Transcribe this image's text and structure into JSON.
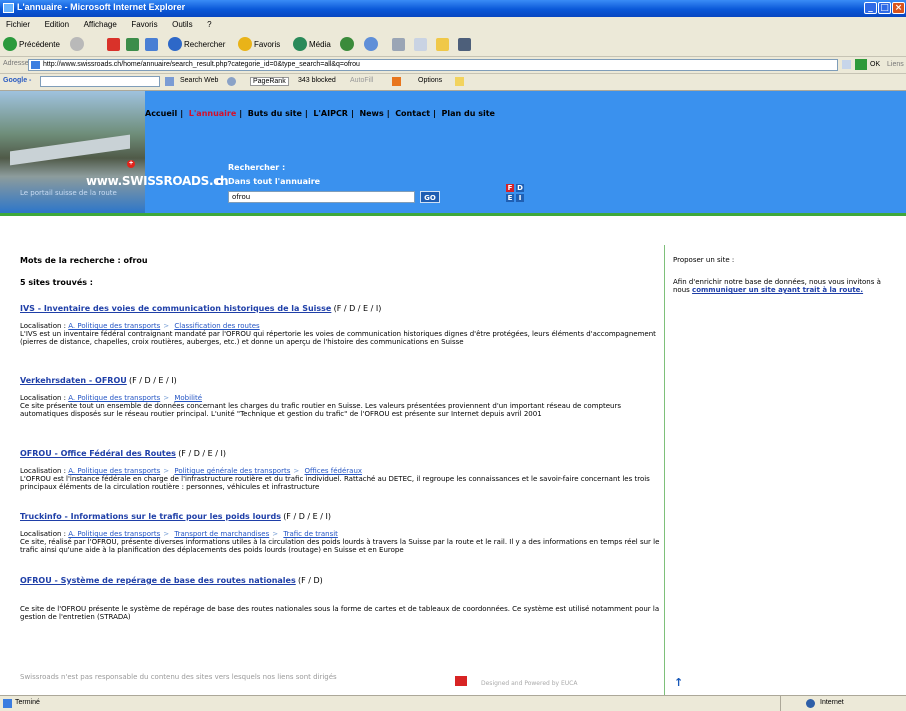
{
  "window": {
    "title": "L'annuaire - Microsoft Internet Explorer"
  },
  "menu": [
    "Fichier",
    "Edition",
    "Affichage",
    "Favoris",
    "Outils",
    "?"
  ],
  "toolbar": {
    "back": "Précédente",
    "search": "Rechercher",
    "favorites": "Favoris",
    "media": "Média"
  },
  "address": {
    "label": "Adresse",
    "url": "http://www.swissroads.ch/home/annuaire/search_result.php?categorie_id=0&type_search=all&q=ofrou",
    "go": "OK",
    "links": "Liens"
  },
  "googlebar": {
    "brand": "Google -",
    "search_web": "Search Web",
    "pagerank": "PageRank",
    "blocked": "343 blocked",
    "autofill": "AutoFill",
    "options": "Options"
  },
  "site": {
    "nav": [
      "Accueil",
      "L'annuaire",
      "Buts du site",
      "L'AIPCR",
      "News",
      "Contact",
      "Plan du site"
    ],
    "logo": "www.SWISSROADS.ch",
    "tagline": "Le portail suisse de la route",
    "search_label": "Rechercher :",
    "radio_label": "Dans tout l'annuaire",
    "query": "ofrou",
    "go": "GO",
    "langs": [
      "F",
      "D",
      "E",
      "I"
    ]
  },
  "results": {
    "keywords": "Mots de la recherche : ofrou",
    "count": "5 sites trouvés :",
    "loc_label": "Localisation :",
    "items": [
      {
        "title": "IVS - Inventaire des voies de communication historiques de la Suisse",
        "lang": "(F / D / E / I)",
        "path": [
          "A. Politique des transports",
          "Classification des routes"
        ],
        "desc": "L'IVS est un inventaire fédéral contraignant mandaté par l'OFROU qui répertorie les voies de communication historiques dignes d'être protégées, leurs éléments d'accompagnement (pierres de distance, chapelles, croix routières, auberges, etc.) et donne un aperçu de l'histoire des communications en Suisse"
      },
      {
        "title": "Verkehrsdaten - OFROU",
        "lang": "(F / D / E / I)",
        "path": [
          "A. Politique des transports",
          "Mobilité"
        ],
        "desc": "Ce site présente tout un ensemble de données concernant les charges du trafic routier en Suisse. Les valeurs présentées proviennent d'un important réseau de compteurs automatiques disposés sur le réseau routier principal. L'unité \"Technique et gestion du trafic\" de l'OFROU est présente sur Internet depuis avril 2001"
      },
      {
        "title": "OFROU - Office Fédéral des Routes",
        "lang": "(F / D / E / I)",
        "path": [
          "A. Politique des transports",
          "Politique générale des transports",
          "Offices fédéraux"
        ],
        "desc": "L'OFROU est l'instance fédérale en charge de l'infrastructure routière et du trafic individuel. Rattaché au DETEC, il regroupe les connaissances et le savoir-faire concernant les trois principaux éléments de la circulation routière : personnes, véhicules et infrastructure"
      },
      {
        "title": "Truckinfo - Informations sur le trafic pour les poids lourds",
        "lang": "(F / D / E / I)",
        "path": [
          "A. Politique des transports",
          "Transport de marchandises",
          "Trafic de transit"
        ],
        "desc": "Ce site, réalisé par l'OFROU, présente diverses informations utiles à la circulation des poids lourds à travers la Suisse par la route et le rail. Il y a des informations en temps réel sur le trafic ainsi qu'une aide à la planification des déplacements des poids lourds (routage) en Suisse et en Europe"
      },
      {
        "title": "OFROU - Système de repérage de base des routes nationales",
        "lang": "(F / D)",
        "path": [],
        "desc": "Ce site de l'OFROU présente le système de repérage de base des routes nationales sous la forme de cartes et de tableaux de coordonnées. Ce système est utilisé notamment pour la gestion de l'entretien (STRADA)"
      }
    ]
  },
  "sidebar": {
    "title": "Proposer un site :",
    "text": "Afin d'enrichir notre base de données, nous vous invitons à nous",
    "link": "communiquer un site ayant trait à la route."
  },
  "footer": {
    "disclaimer": "Swissroads n'est pas responsable du contenu des sites vers lesquels nos liens sont dirigés",
    "powered": "Designed and Powered by EUCA",
    "up": "↑"
  },
  "status": {
    "left": "Terminé",
    "zone": "Internet"
  }
}
